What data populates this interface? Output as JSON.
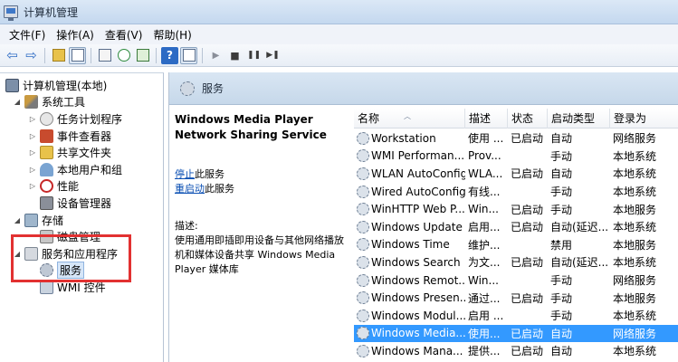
{
  "window": {
    "title": "计算机管理"
  },
  "menu": [
    "文件(F)",
    "操作(A)",
    "查看(V)",
    "帮助(H)"
  ],
  "toolbar": {
    "icons": [
      "back-arrow-icon",
      "forward-arrow-icon",
      "up-folder-icon",
      "show-tree-icon",
      "properties-icon",
      "refresh-icon",
      "export-icon",
      "help-icon",
      "console-view-icon",
      "play-icon",
      "stop-icon",
      "pause-icon",
      "restart-icon"
    ],
    "glyphs": {
      "back": "⇦",
      "forward": "⇨",
      "help": "?",
      "play": "▶",
      "stop": "■",
      "pause": "❚❚",
      "restart": "▶❚"
    }
  },
  "tree": {
    "root": "计算机管理(本地)",
    "system_tools": "系统工具",
    "task_scheduler": "任务计划程序",
    "event_viewer": "事件查看器",
    "shared_folders": "共享文件夹",
    "local_users": "本地用户和组",
    "performance": "性能",
    "device_manager": "设备管理器",
    "storage": "存储",
    "disk_management": "磁盘管理",
    "services_apps": "服务和应用程序",
    "services": "服务",
    "wmi": "WMI 控件"
  },
  "header": {
    "title": "服务"
  },
  "detail": {
    "service_name": "Windows Media Player Network Sharing Service",
    "stop_link": "停止",
    "stop_suffix": "此服务",
    "restart_link": "重启动",
    "restart_suffix": "此服务",
    "desc_label": "描述:",
    "description": "使用通用即插即用设备与其他网络播放机和媒体设备共享 Windows Media Player 媒体库"
  },
  "columns": [
    "名称",
    "描述",
    "状态",
    "启动类型",
    "登录为"
  ],
  "rows": [
    [
      "Workstation",
      "使用 ...",
      "已启动",
      "自动",
      "网络服务"
    ],
    [
      "WMI Performan...",
      "Prov...",
      "",
      "手动",
      "本地系统"
    ],
    [
      "WLAN AutoConfig",
      "WLA...",
      "已启动",
      "自动",
      "本地系统"
    ],
    [
      "Wired AutoConfig",
      "有线...",
      "",
      "手动",
      "本地系统"
    ],
    [
      "WinHTTP Web P...",
      "Win...",
      "已启动",
      "手动",
      "本地服务"
    ],
    [
      "Windows Update",
      "启用...",
      "已启动",
      "自动(延迟...",
      "本地系统"
    ],
    [
      "Windows Time",
      "维护...",
      "",
      "禁用",
      "本地服务"
    ],
    [
      "Windows Search",
      "为文...",
      "已启动",
      "自动(延迟...",
      "本地系统"
    ],
    [
      "Windows Remot...",
      "Win...",
      "",
      "手动",
      "网络服务"
    ],
    [
      "Windows Presen...",
      "通过...",
      "已启动",
      "手动",
      "本地服务"
    ],
    [
      "Windows Modul...",
      "启用 ...",
      "",
      "手动",
      "本地系统"
    ],
    [
      "Windows Media...",
      "使用...",
      "已启动",
      "自动",
      "网络服务"
    ],
    [
      "Windows Mana...",
      "提供...",
      "已启动",
      "自动",
      "本地系统"
    ]
  ],
  "selected_row": 11,
  "colors": {
    "selection": "#3399ff",
    "highlight_box": "#e23131",
    "link": "#0b4fb3"
  }
}
